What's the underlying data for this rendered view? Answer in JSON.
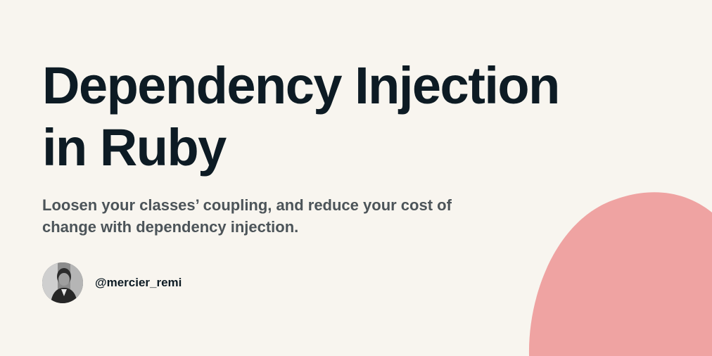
{
  "title": {
    "line1": "Dependency Injection",
    "line2": "in Ruby"
  },
  "subtitle": "Loosen your classes’ coupling, and reduce your cost of change with dependency injection.",
  "author": {
    "handle": "@mercier_remi",
    "avatar_icon": "person-photo-icon"
  },
  "colors": {
    "background": "#f8f5ef",
    "title": "#0d1b24",
    "subtitle": "#4c5459",
    "blob": "#efa3a2"
  }
}
